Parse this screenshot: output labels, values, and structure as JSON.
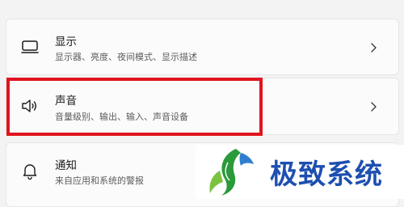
{
  "settings": {
    "items": [
      {
        "title": "显示",
        "subtitle": "显示器、亮度、夜间模式、显示描述",
        "icon": "monitor-icon"
      },
      {
        "title": "声音",
        "subtitle": "音量级别、输出、输入、声音设备",
        "icon": "speaker-icon",
        "highlighted": true
      },
      {
        "title": "通知",
        "subtitle": "来自应用和系统的警报",
        "icon": "bell-icon"
      }
    ]
  },
  "watermark": {
    "text": "极致系统"
  },
  "colors": {
    "page_bg": "#f3f3f3",
    "card_bg": "#fbfbfb",
    "highlight": "#e0141e",
    "watermark_text": "#1d4fb0",
    "watermark_logo": "#2a9a3a"
  }
}
